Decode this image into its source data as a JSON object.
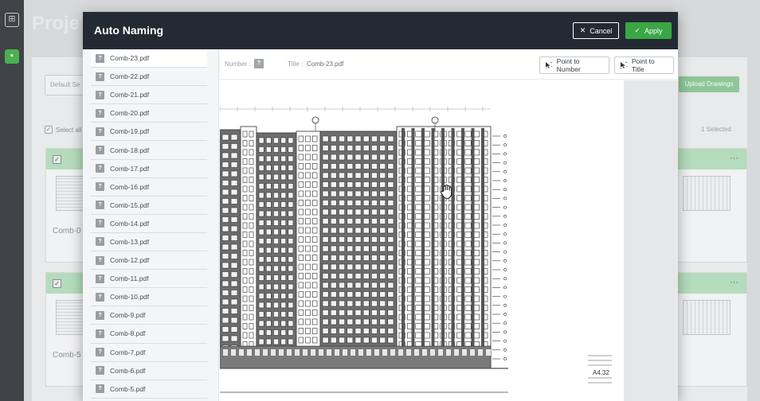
{
  "background": {
    "title": "Proje",
    "filter_placeholder": "Default Se",
    "upload_label": "Upload Drawings",
    "select_all_label": "Select all",
    "count_label": "1 Selected",
    "cards": [
      "Comb-0",
      "Comb-5"
    ]
  },
  "modal": {
    "title": "Auto Naming",
    "cancel_label": "Cancel",
    "apply_label": "Apply",
    "cancel_icon": "close-icon",
    "apply_icon": "check-icon"
  },
  "files": [
    {
      "badge": "?",
      "name": "Comb-23.pdf",
      "active": true
    },
    {
      "badge": "?",
      "name": "Comb-22.pdf"
    },
    {
      "badge": "?",
      "name": "Comb-21.pdf"
    },
    {
      "badge": "?",
      "name": "Comb-20.pdf"
    },
    {
      "badge": "?",
      "name": "Comb-19.pdf"
    },
    {
      "badge": "?",
      "name": "Comb-18.pdf"
    },
    {
      "badge": "?",
      "name": "Comb-17.pdf"
    },
    {
      "badge": "?",
      "name": "Comb-16.pdf"
    },
    {
      "badge": "?",
      "name": "Comb-15.pdf"
    },
    {
      "badge": "?",
      "name": "Comb-14.pdf"
    },
    {
      "badge": "?",
      "name": "Comb-13.pdf"
    },
    {
      "badge": "?",
      "name": "Comb-12.pdf"
    },
    {
      "badge": "?",
      "name": "Comb-11.pdf"
    },
    {
      "badge": "?",
      "name": "Comb-10.pdf"
    },
    {
      "badge": "?",
      "name": "Comb-9.pdf"
    },
    {
      "badge": "?",
      "name": "Comb-8.pdf"
    },
    {
      "badge": "?",
      "name": "Comb-7.pdf"
    },
    {
      "badge": "?",
      "name": "Comb-6.pdf"
    },
    {
      "badge": "?",
      "name": "Comb-5.pdf"
    }
  ],
  "topbar": {
    "number_label": "Number :",
    "number_value": "?",
    "title_label": "Title :",
    "title_value": "Comb-23.pdf",
    "point_number_label": "Point to Number",
    "point_title_label": "Point to Title"
  },
  "viewer": {
    "sheet_number": "A4.32"
  },
  "colors": {
    "header_bg": "#232a33",
    "apply_green": "#3aa646",
    "accent_green_bg": "#b5dcbc"
  }
}
